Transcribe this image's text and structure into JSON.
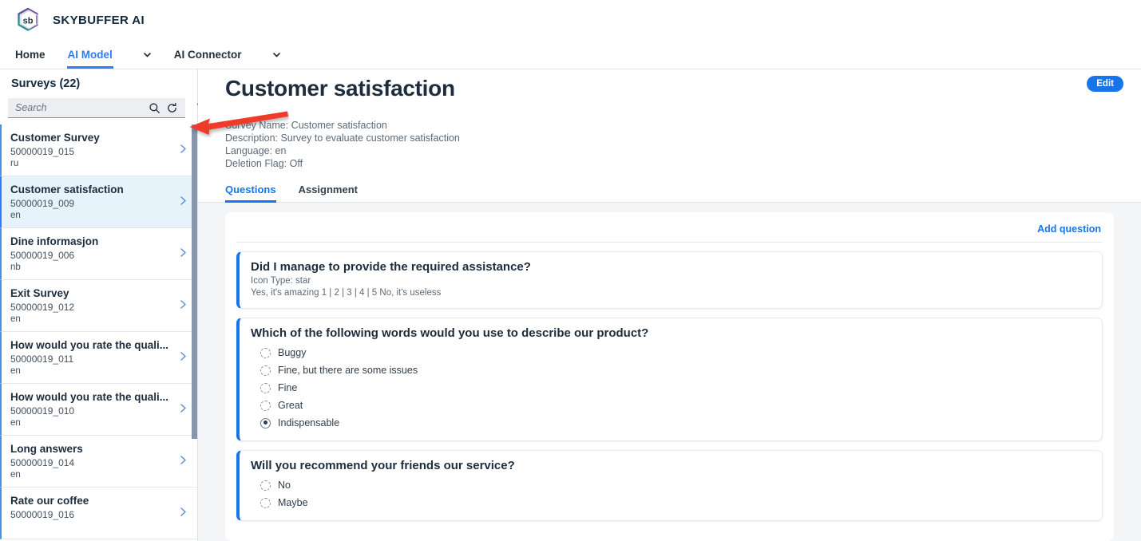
{
  "app": {
    "brand": "SKYBUFFER AI",
    "logo_icon": "skybuffer-hexagon-logo"
  },
  "nav": {
    "items": [
      {
        "label": "Home",
        "active": false,
        "has_caret": false
      },
      {
        "label": "AI Model",
        "active": true,
        "has_caret": true
      },
      {
        "label": "AI Connector",
        "active": false,
        "has_caret": true
      }
    ],
    "caret_icon": "chevron-down-icon",
    "accent_color": "#2e7df6"
  },
  "sidebar": {
    "title": "Surveys (22)",
    "search": {
      "placeholder": "Search",
      "value": "",
      "search_icon": "search-icon",
      "refresh_icon": "refresh-icon"
    },
    "filter_icon": "filter-funnel-icon",
    "add_icon": "plus-icon",
    "chevron_icon": "chevron-right-icon",
    "items": [
      {
        "name": "Customer Survey",
        "id": "50000019_015",
        "lang": "ru",
        "selected": false
      },
      {
        "name": "Customer satisfaction",
        "id": "50000019_009",
        "lang": "en",
        "selected": true
      },
      {
        "name": "Dine informasjon",
        "id": "50000019_006",
        "lang": "nb",
        "selected": false
      },
      {
        "name": "Exit Survey",
        "id": "50000019_012",
        "lang": "en",
        "selected": false
      },
      {
        "name": "How would you rate the quali...",
        "id": "50000019_011",
        "lang": "en",
        "selected": false
      },
      {
        "name": "How would you rate the quali...",
        "id": "50000019_010",
        "lang": "en",
        "selected": false
      },
      {
        "name": "Long answers",
        "id": "50000019_014",
        "lang": "en",
        "selected": false
      },
      {
        "name": "Rate our coffee",
        "id": "50000019_016",
        "lang": "",
        "selected": false
      }
    ]
  },
  "main": {
    "title": "Customer satisfaction",
    "edit_label": "Edit",
    "meta": [
      "Survey Name: Customer satisfaction",
      "Description: Survey to evaluate customer satisfaction",
      "Language: en",
      "Deletion Flag: Off"
    ],
    "tabs": [
      {
        "label": "Questions",
        "active": true
      },
      {
        "label": "Assignment",
        "active": false
      }
    ],
    "add_question_label": "Add question",
    "questions": [
      {
        "title": "Did I manage to provide the required assistance?",
        "sublines": [
          "Icon Type: star",
          "Yes, it's amazing 1 | 2 | 3 | 4 | 5 No, it's useless"
        ],
        "options": []
      },
      {
        "title": "Which of the following words would you use to describe our product?",
        "sublines": [],
        "options": [
          {
            "label": "Buggy",
            "checked": false
          },
          {
            "label": "Fine, but there are some issues",
            "checked": false
          },
          {
            "label": "Fine",
            "checked": false
          },
          {
            "label": "Great",
            "checked": false
          },
          {
            "label": "Indispensable",
            "checked": true
          }
        ]
      },
      {
        "title": "Will you recommend your friends our service?",
        "sublines": [],
        "options": [
          {
            "label": "No",
            "checked": false
          },
          {
            "label": "Maybe",
            "checked": false
          }
        ]
      }
    ]
  },
  "annotation": {
    "arrow_icon": "red-left-arrow-annotation",
    "color": "#ee3b2b"
  }
}
